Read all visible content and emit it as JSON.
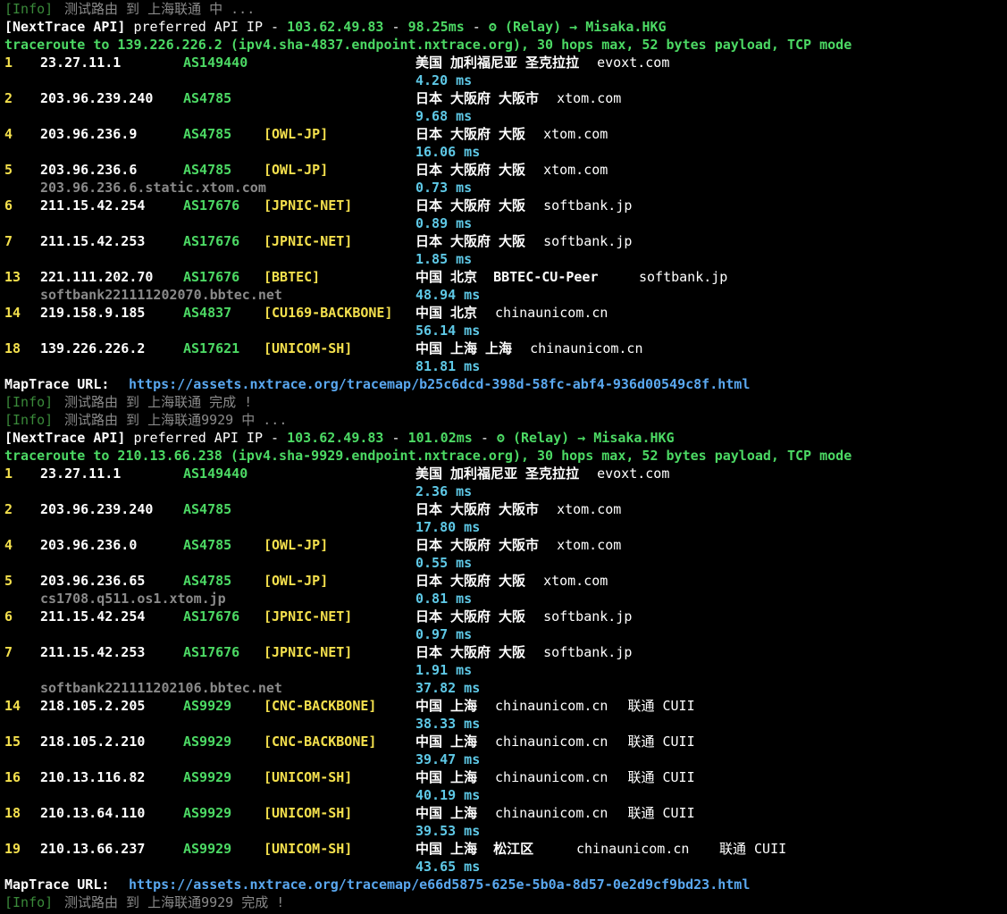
{
  "colors": {
    "background": "#000000",
    "info_tag": "#3a8a3a",
    "hostname": "#8a8a8a",
    "hop_number": "#f4e04d",
    "ip": "#ffffff",
    "asn": "#4cd964",
    "tag": "#f4e04d",
    "latency": "#5ec8e6",
    "url": "#5aa8f0",
    "header_green": "#4cd964"
  },
  "lines": [
    {
      "kind": "info",
      "tag": "[Info]",
      "text": " 测试路由 到 上海联通 中 ..."
    },
    {
      "kind": "api",
      "label": "[NextTrace API]",
      "mid": " preferred API IP - ",
      "ip": "103.62.49.83",
      "sep1": " - ",
      "latency": "98.25ms",
      "sep2": " - ",
      "icon_glyph": "ʘ",
      "icon": "relay-icon",
      "tail": " (Relay) → Misaka.HKG"
    },
    {
      "kind": "header",
      "text": "traceroute to 139.226.226.2 (ipv4.sha-4837.endpoint.nxtrace.org), 30 hops max, 52 bytes payload, TCP mode"
    },
    {
      "kind": "hop",
      "num": "1",
      "ip": "23.27.11.1",
      "asn": "AS149440",
      "tag": "",
      "geo": "美国 加利福尼亚 圣克拉拉",
      "domain": "evoxt.com"
    },
    {
      "kind": "sub",
      "host": "",
      "latency": "4.20 ms"
    },
    {
      "kind": "hop",
      "num": "2",
      "ip": "203.96.239.240",
      "asn": "AS4785",
      "tag": "",
      "geo": "日本 大阪府 大阪市",
      "domain": "xtom.com"
    },
    {
      "kind": "sub",
      "host": "",
      "latency": "9.68 ms"
    },
    {
      "kind": "hop",
      "num": "4",
      "ip": "203.96.236.9",
      "asn": "AS4785",
      "tag": "[OWL-JP]",
      "geo": "日本 大阪府 大阪",
      "domain": "xtom.com"
    },
    {
      "kind": "sub",
      "host": "",
      "latency": "16.06 ms"
    },
    {
      "kind": "hop",
      "num": "5",
      "ip": "203.96.236.6",
      "asn": "AS4785",
      "tag": "[OWL-JP]",
      "geo": "日本 大阪府 大阪",
      "domain": "xtom.com"
    },
    {
      "kind": "sub",
      "host": "203.96.236.6.static.xtom.com",
      "latency": "0.73 ms"
    },
    {
      "kind": "hop",
      "num": "6",
      "ip": "211.15.42.254",
      "asn": "AS17676",
      "tag": "[JPNIC-NET]",
      "geo": "日本 大阪府 大阪",
      "domain": "softbank.jp"
    },
    {
      "kind": "sub",
      "host": "",
      "latency": "0.89 ms"
    },
    {
      "kind": "hop",
      "num": "7",
      "ip": "211.15.42.253",
      "asn": "AS17676",
      "tag": "[JPNIC-NET]",
      "geo": "日本 大阪府 大阪",
      "domain": "softbank.jp"
    },
    {
      "kind": "sub",
      "host": "",
      "latency": "1.85 ms"
    },
    {
      "kind": "hop",
      "num": "13",
      "ip": "221.111.202.70",
      "asn": "AS17676",
      "tag": "[BBTEC]",
      "geo": "中国 北京  BBTEC-CU-Peer",
      "domain": "softbank.jp",
      "domain_col": "715"
    },
    {
      "kind": "sub",
      "host": "softbank221111202070.bbtec.net",
      "latency": "48.94 ms"
    },
    {
      "kind": "hop",
      "num": "14",
      "ip": "219.158.9.185",
      "asn": "AS4837",
      "tag": "[CU169-BACKBONE]",
      "geo": "中国 北京",
      "domain": "chinaunicom.cn"
    },
    {
      "kind": "sub",
      "host": "",
      "latency": "56.14 ms"
    },
    {
      "kind": "hop",
      "num": "18",
      "ip": "139.226.226.2",
      "asn": "AS17621",
      "tag": "[UNICOM-SH]",
      "geo": "中国 上海 上海",
      "domain": "chinaunicom.cn"
    },
    {
      "kind": "sub",
      "host": "",
      "latency": "81.81 ms"
    },
    {
      "kind": "map",
      "label": "MapTrace URL:",
      "url": "https://assets.nxtrace.org/tracemap/b25c6dcd-398d-58fc-abf4-936d00549c8f.html"
    },
    {
      "kind": "info",
      "tag": "[Info]",
      "text": " 测试路由 到 上海联通 完成 !"
    },
    {
      "kind": "info",
      "tag": "[Info]",
      "text": " 测试路由 到 上海联通9929 中 ..."
    },
    {
      "kind": "api",
      "label": "[NextTrace API]",
      "mid": " preferred API IP - ",
      "ip": "103.62.49.83",
      "sep1": " - ",
      "latency": "101.02ms",
      "sep2": " - ",
      "icon_glyph": "ʘ",
      "icon": "relay-icon",
      "tail": " (Relay) → Misaka.HKG"
    },
    {
      "kind": "header",
      "text": "traceroute to 210.13.66.238 (ipv4.sha-9929.endpoint.nxtrace.org), 30 hops max, 52 bytes payload, TCP mode"
    },
    {
      "kind": "hop",
      "num": "1",
      "ip": "23.27.11.1",
      "asn": "AS149440",
      "tag": "",
      "geo": "美国 加利福尼亚 圣克拉拉",
      "domain": "evoxt.com"
    },
    {
      "kind": "sub",
      "host": "",
      "latency": "2.36 ms"
    },
    {
      "kind": "hop",
      "num": "2",
      "ip": "203.96.239.240",
      "asn": "AS4785",
      "tag": "",
      "geo": "日本 大阪府 大阪市",
      "domain": "xtom.com"
    },
    {
      "kind": "sub",
      "host": "",
      "latency": "17.80 ms"
    },
    {
      "kind": "hop",
      "num": "4",
      "ip": "203.96.236.0",
      "asn": "AS4785",
      "tag": "[OWL-JP]",
      "geo": "日本 大阪府 大阪市",
      "domain": "xtom.com"
    },
    {
      "kind": "sub",
      "host": "",
      "latency": "0.55 ms"
    },
    {
      "kind": "hop",
      "num": "5",
      "ip": "203.96.236.65",
      "asn": "AS4785",
      "tag": "[OWL-JP]",
      "geo": "日本 大阪府 大阪",
      "domain": "xtom.com"
    },
    {
      "kind": "sub",
      "host": "cs1708.q511.os1.xtom.jp",
      "latency": "0.81 ms"
    },
    {
      "kind": "hop",
      "num": "6",
      "ip": "211.15.42.254",
      "asn": "AS17676",
      "tag": "[JPNIC-NET]",
      "geo": "日本 大阪府 大阪",
      "domain": "softbank.jp"
    },
    {
      "kind": "sub",
      "host": "",
      "latency": "0.97 ms"
    },
    {
      "kind": "hop",
      "num": "7",
      "ip": "211.15.42.253",
      "asn": "AS17676",
      "tag": "[JPNIC-NET]",
      "geo": "日本 大阪府 大阪",
      "domain": "softbank.jp"
    },
    {
      "kind": "sub",
      "host": "",
      "latency": "1.91 ms"
    },
    {
      "kind": "sub",
      "host": "softbank221111202106.bbtec.net",
      "latency": "37.82 ms"
    },
    {
      "kind": "hop",
      "num": "14",
      "ip": "218.105.2.205",
      "asn": "AS9929",
      "tag": "[CNC-BACKBONE]",
      "geo": "中国 上海",
      "domain": "chinaunicom.cn",
      "isp": "联通 CUII"
    },
    {
      "kind": "sub",
      "host": "",
      "latency": "38.33 ms"
    },
    {
      "kind": "hop",
      "num": "15",
      "ip": "218.105.2.210",
      "asn": "AS9929",
      "tag": "[CNC-BACKBONE]",
      "geo": "中国 上海",
      "domain": "chinaunicom.cn",
      "isp": "联通 CUII"
    },
    {
      "kind": "sub",
      "host": "",
      "latency": "39.47 ms"
    },
    {
      "kind": "hop",
      "num": "16",
      "ip": "210.13.116.82",
      "asn": "AS9929",
      "tag": "[UNICOM-SH]",
      "geo": "中国 上海",
      "domain": "chinaunicom.cn",
      "isp": "联通 CUII"
    },
    {
      "kind": "sub",
      "host": "",
      "latency": "40.19 ms"
    },
    {
      "kind": "hop",
      "num": "18",
      "ip": "210.13.64.110",
      "asn": "AS9929",
      "tag": "[UNICOM-SH]",
      "geo": "中国 上海",
      "domain": "chinaunicom.cn",
      "isp": "联通 CUII"
    },
    {
      "kind": "sub",
      "host": "",
      "latency": "39.53 ms"
    },
    {
      "kind": "hop",
      "num": "19",
      "ip": "210.13.66.237",
      "asn": "AS9929",
      "tag": "[UNICOM-SH]",
      "geo": "中国 上海  松江区",
      "domain": "chinaunicom.cn",
      "isp": "联通 CUII",
      "domain_col": "645",
      "isp_col": "805"
    },
    {
      "kind": "sub",
      "host": "",
      "latency": "43.65 ms"
    },
    {
      "kind": "map",
      "label": "MapTrace URL:",
      "url": "https://assets.nxtrace.org/tracemap/e66d5875-625e-5b0a-8d57-0e2d9cf9bd23.html"
    },
    {
      "kind": "info",
      "tag": "[Info]",
      "text": " 测试路由 到 上海联通9929 完成 !"
    }
  ]
}
